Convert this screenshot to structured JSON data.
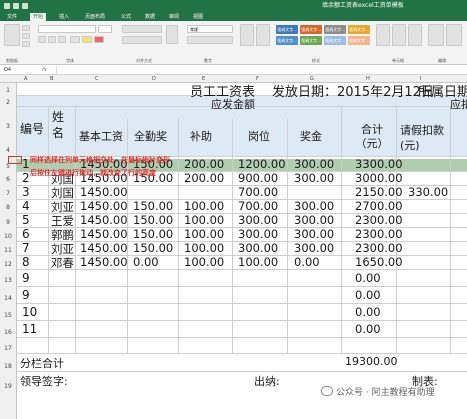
{
  "window": {
    "title": "填余额工资表excel工资单模板"
  },
  "menu": [
    "文件",
    "开始",
    "插入",
    "页面布局",
    "公式",
    "数据",
    "审阅",
    "视图"
  ],
  "ribbon": {
    "format_box": "常规",
    "styles": [
      {
        "label": "强调文字...",
        "color": "#3b78bd"
      },
      {
        "label": "强调文字...",
        "color": "#d4682b"
      },
      {
        "label": "强调文字...",
        "color": "#8c8c8c"
      },
      {
        "label": "强调文字...",
        "color": "#e3a92c"
      },
      {
        "label": "强调文字...",
        "color": "#4f8fd1"
      },
      {
        "label": "强调文字...",
        "color": "#6aa84f"
      },
      {
        "label": "强调文字...",
        "color": "#9dbce3"
      },
      {
        "label": "强调文字...",
        "color": "#f0b58a"
      }
    ],
    "groups": [
      "剪贴板",
      "字体",
      "对齐方式",
      "数字",
      "样式",
      "单元格",
      "编辑"
    ]
  },
  "formula_bar": {
    "name_box": "O4",
    "fx": "fx"
  },
  "columns": [
    "A",
    "B",
    "C",
    "D",
    "E",
    "F",
    "G",
    "H",
    "I",
    "J",
    "K"
  ],
  "sheet": {
    "banner": {
      "title": "员工工资表",
      "date": "发放日期：2015年2月12日",
      "dept": "所属日期"
    },
    "group_header": "应发金额",
    "group_header_right": "应扣",
    "headers": {
      "no": "编号",
      "name": "姓名",
      "base": "基本工资",
      "attendance": "全勤奖",
      "allowance": "补助",
      "post": "岗位",
      "bonus": "奖金",
      "total": "合计（元）",
      "leave": "请假扣款(元)"
    },
    "rows": [
      {
        "no": "1",
        "name": "",
        "base": "1450.00",
        "attendance": "150.00",
        "allowance": "200.00",
        "post": "1200.00",
        "bonus": "300.00",
        "total": "3300.00",
        "leave": ""
      },
      {
        "no": "2",
        "name": "刘国",
        "base": "1450.00",
        "attendance": "150.00",
        "allowance": "200.00",
        "post": "900.00",
        "bonus": "300.00",
        "total": "3000.00",
        "leave": ""
      },
      {
        "no": "3",
        "name": "刘国",
        "base": "1450.00",
        "attendance": "",
        "allowance": "",
        "post": "700.00",
        "bonus": "",
        "total": "2150.00",
        "leave": "330.00"
      },
      {
        "no": "4",
        "name": "刘亚",
        "base": "1450.00",
        "attendance": "150.00",
        "allowance": "100.00",
        "post": "700.00",
        "bonus": "300.00",
        "total": "2700.00",
        "leave": ""
      },
      {
        "no": "5",
        "name": "王爱",
        "base": "1450.00",
        "attendance": "150.00",
        "allowance": "100.00",
        "post": "300.00",
        "bonus": "300.00",
        "total": "2300.00",
        "leave": ""
      },
      {
        "no": "6",
        "name": "郭鹏",
        "base": "1450.00",
        "attendance": "150.00",
        "allowance": "100.00",
        "post": "300.00",
        "bonus": "300.00",
        "total": "2300.00",
        "leave": ""
      },
      {
        "no": "7",
        "name": "刘亚",
        "base": "1450.00",
        "attendance": "150.00",
        "allowance": "100.00",
        "post": "300.00",
        "bonus": "300.00",
        "total": "2300.00",
        "leave": ""
      },
      {
        "no": "8",
        "name": "邓春",
        "base": "1450.00",
        "attendance": "0.00",
        "allowance": "100.00",
        "post": "100.00",
        "bonus": "0.00",
        "total": "1650.00",
        "leave": ""
      },
      {
        "no": "9",
        "name": "",
        "base": "",
        "attendance": "",
        "allowance": "",
        "post": "",
        "bonus": "",
        "total": "0.00",
        "leave": ""
      },
      {
        "no": "9",
        "name": "",
        "base": "",
        "attendance": "",
        "allowance": "",
        "post": "",
        "bonus": "",
        "total": "0.00",
        "leave": ""
      },
      {
        "no": "10",
        "name": "",
        "base": "",
        "attendance": "",
        "allowance": "",
        "post": "",
        "bonus": "",
        "total": "0.00",
        "leave": ""
      },
      {
        "no": "11",
        "name": "",
        "base": "",
        "attendance": "",
        "allowance": "",
        "post": "",
        "bonus": "",
        "total": "0.00",
        "leave": ""
      }
    ],
    "subtotal": {
      "label": "分栏合计",
      "value": "19300.00"
    },
    "footer": {
      "sign": "领导签字:",
      "cashier": "出纳:",
      "maker": "制表:"
    }
  },
  "annotation": {
    "line1": "同样选择在列单元格相交处，在鼠标指针变形",
    "line2": "后按住左键进行拖动，就改变了行的高度"
  },
  "watermark": "公众号 · 阿主教程有助理"
}
